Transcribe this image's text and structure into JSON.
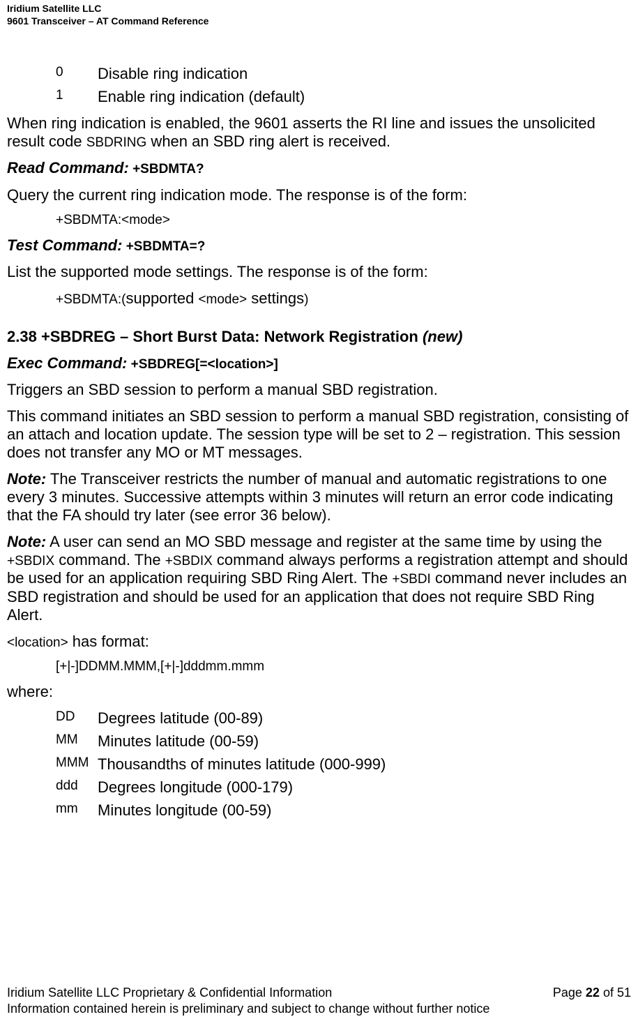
{
  "header": {
    "line1": "Iridium Satellite LLC",
    "line2": "9601 Transceiver – AT Command Reference"
  },
  "defs_top": [
    {
      "code": "0",
      "text": "Disable ring indication"
    },
    {
      "code": "1",
      "text": "Enable ring indication (default)"
    }
  ],
  "p_ring_enabled_a": "When ring indication is enabled, the 9601 asserts the RI line and issues the unsolicited result code ",
  "p_ring_enabled_code": "SBDRING",
  "p_ring_enabled_b": " when an SBD ring alert is received.",
  "read_cmd_label": "Read Command:",
  "read_cmd_code": " +SBDMTA?",
  "read_cmd_desc": "Query the current ring indication mode.  The response is of the form:",
  "read_cmd_resp": "+SBDMTA:<mode>",
  "test_cmd_label": "Test Command:",
  "test_cmd_code": " +SBDMTA=?",
  "test_cmd_desc": "List the supported mode settings. The response is of the form:",
  "test_cmd_resp_a": "+SBDMTA:(",
  "test_cmd_resp_b": "supported ",
  "test_cmd_resp_c": "<mode>",
  "test_cmd_resp_d": " settings",
  "test_cmd_resp_e": ")",
  "section_no": "2.38",
  "section_title": "  +SBDREG – Short Burst Data: Network Registration ",
  "section_new": "(new)",
  "exec_cmd_label": "Exec Command:",
  "exec_cmd_code": " +SBDREG[=<location>]",
  "exec_summary": "Triggers an SBD session to perform a manual SBD registration.",
  "exec_detail": "This command initiates an SBD session to perform a manual SBD registration, consisting of an attach and location update.  The session type will be set to 2 – registration.  This session does not transfer any MO or MT messages.",
  "note_label": "Note:",
  "note1": "  The Transceiver restricts the number of manual and automatic registrations to one every 3 minutes.  Successive attempts within 3 minutes will return an error code indicating that the FA should try later (see error 36 below).",
  "note2_a": "  A user can send an MO SBD message and register at the same time by using the ",
  "note2_cmd1": "+SBDIX",
  "note2_b": " command.  The ",
  "note2_cmd2": "+SBDIX",
  "note2_c": " command always performs a registration attempt and should be used for an application requiring SBD Ring Alert.  The ",
  "note2_cmd3": "+SBDI",
  "note2_d": " command never includes an SBD registration and should be used for an application that does not require SBD Ring Alert.",
  "loc_has_fmt_a": "<location>",
  "loc_has_fmt_b": " has format:",
  "loc_format": "[+|-]DDMM.MMM,[+|-]dddmm.mmm",
  "where": "where:",
  "loc_defs": [
    {
      "code": "DD",
      "text": "Degrees latitude (00-89)"
    },
    {
      "code": "MM",
      "text": "Minutes latitude (00-59)"
    },
    {
      "code": "MMM",
      "text": "Thousandths of minutes latitude (000-999)"
    },
    {
      "code": "ddd",
      "text": "Degrees longitude (000-179)"
    },
    {
      "code": "mm",
      "text": "Minutes longitude (00-59)"
    }
  ],
  "footer": {
    "left1": "Iridium Satellite LLC Proprietary & Confidential Information",
    "right1_a": "Page ",
    "right1_b": "22",
    "right1_c": " of 51",
    "line2": "Information contained herein is preliminary and subject to change without further notice"
  }
}
